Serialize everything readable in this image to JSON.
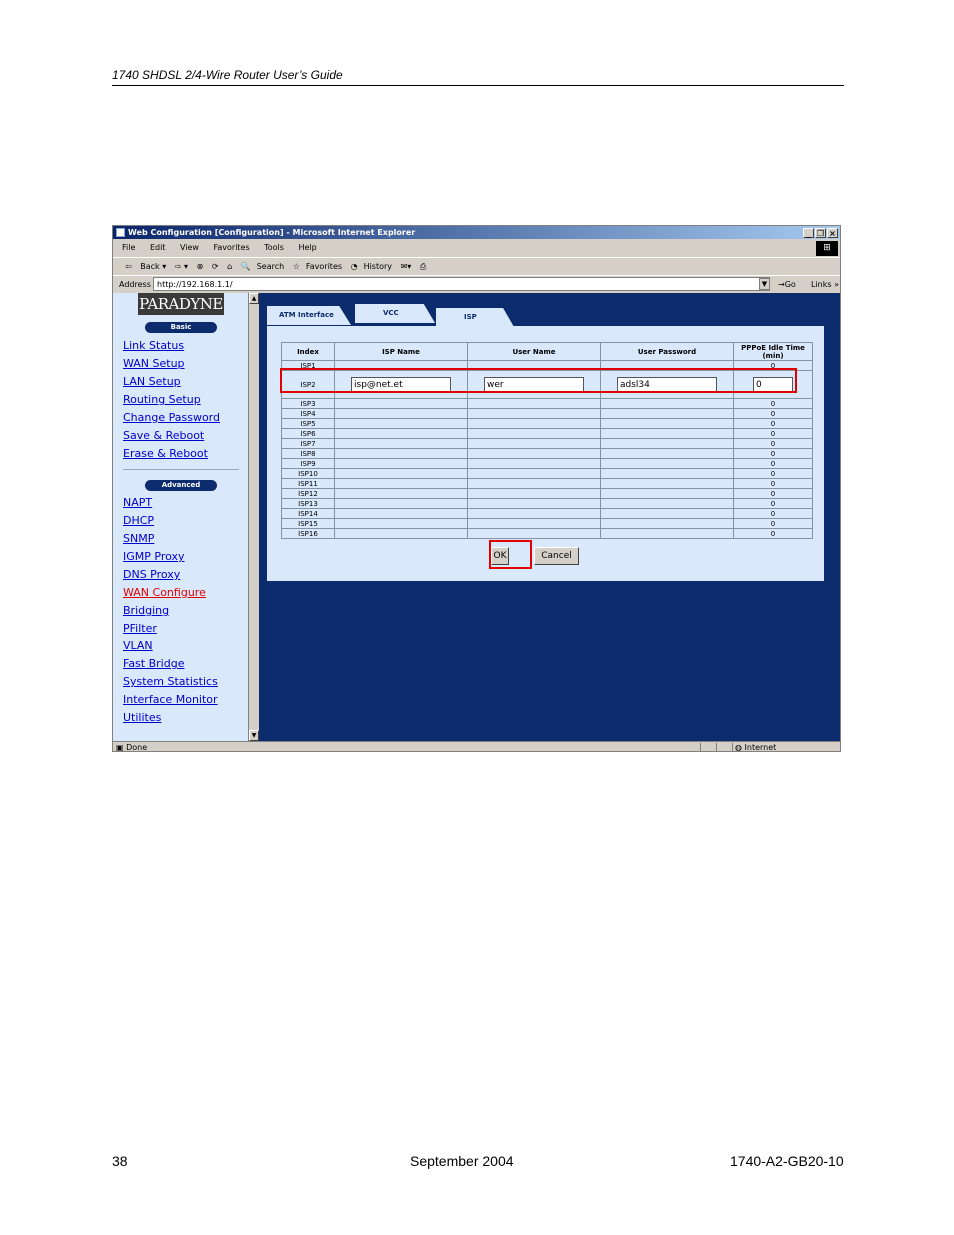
{
  "document": {
    "header": "1740 SHDSL 2/4-Wire Router User’s Guide",
    "footer_page": "38",
    "footer_date": "September 2004",
    "footer_code": "1740-A2-GB20-10"
  },
  "window": {
    "title": "Web Configuration [Configuration] - Microsoft Internet Explorer",
    "menu": [
      "File",
      "Edit",
      "View",
      "Favorites",
      "Tools",
      "Help"
    ],
    "toolbar": [
      "Back",
      "Search",
      "Favorites",
      "History"
    ],
    "address_label": "Address",
    "address": "http://192.168.1.1/",
    "go": "Go",
    "links": "Links",
    "status": "Done",
    "zone": "Internet"
  },
  "sidebar": {
    "logo": "PARADYNE",
    "basic_label": "Basic",
    "basic": [
      "Link Status",
      "WAN Setup",
      "LAN Setup",
      "Routing Setup",
      "Change Password",
      "Save & Reboot",
      "Erase & Reboot"
    ],
    "advanced_label": "Advanced",
    "advanced": [
      "NAPT",
      "DHCP",
      "SNMP",
      "IGMP Proxy",
      "DNS Proxy",
      "WAN Configure",
      "Bridging",
      "PFilter",
      "VLAN",
      "Fast Bridge",
      "System Statistics",
      "Interface Monitor",
      "Utilites"
    ]
  },
  "tabs": [
    "ATM Interface",
    "VCC",
    "ISP"
  ],
  "table": {
    "headers": [
      "Index",
      "ISP Name",
      "User Name",
      "User Password",
      "PPPoE Idle Time\n(min)"
    ],
    "rows": [
      {
        "index": "ISP1",
        "idle": "0"
      },
      {
        "index": "ISP2",
        "isp": "isp@net.et",
        "user": "wer",
        "pass": "adsl34",
        "idle": "0"
      },
      {
        "index": "ISP3",
        "idle": "0"
      },
      {
        "index": "ISP4",
        "idle": "0"
      },
      {
        "index": "ISP5",
        "idle": "0"
      },
      {
        "index": "ISP6",
        "idle": "0"
      },
      {
        "index": "ISP7",
        "idle": "0"
      },
      {
        "index": "ISP8",
        "idle": "0"
      },
      {
        "index": "ISP9",
        "idle": "0"
      },
      {
        "index": "ISP10",
        "idle": "0"
      },
      {
        "index": "ISP11",
        "idle": "0"
      },
      {
        "index": "ISP12",
        "idle": "0"
      },
      {
        "index": "ISP13",
        "idle": "0"
      },
      {
        "index": "ISP14",
        "idle": "0"
      },
      {
        "index": "ISP15",
        "idle": "0"
      },
      {
        "index": "ISP16",
        "idle": "0"
      }
    ]
  },
  "buttons": {
    "ok": "OK",
    "cancel": "Cancel"
  }
}
